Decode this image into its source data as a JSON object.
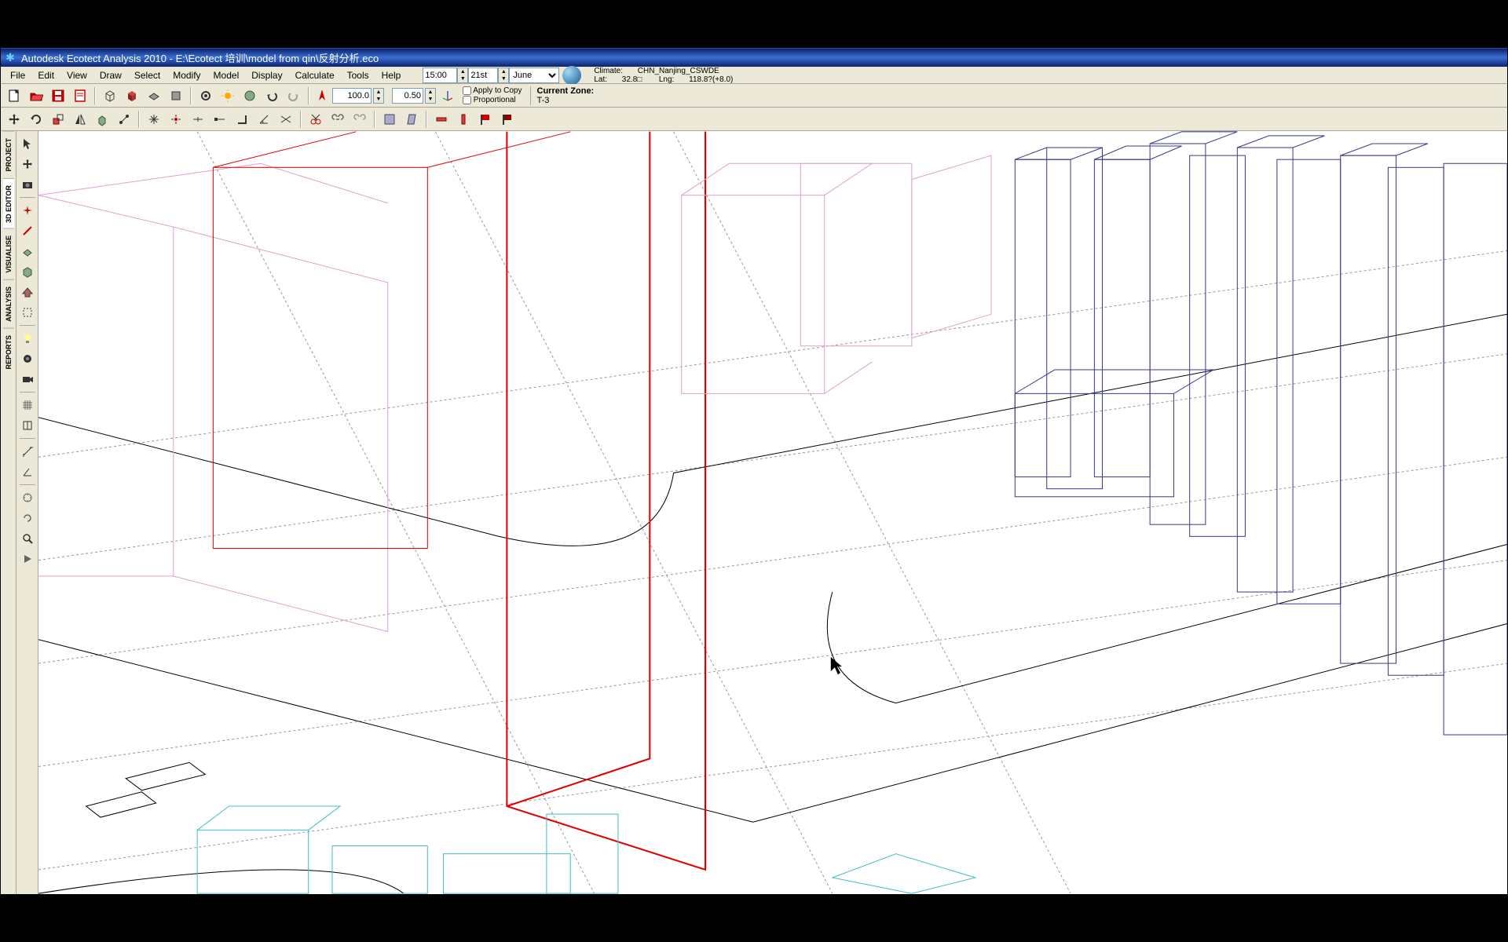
{
  "titlebar": {
    "app_name": "Autodesk Ecotect Analysis 2010",
    "file_path": "E:\\Ecotect 培训\\model from qin\\反射分析.eco"
  },
  "menu": {
    "file": "File",
    "edit": "Edit",
    "view": "View",
    "draw": "Draw",
    "select": "Select",
    "modify": "Modify",
    "model": "Model",
    "display": "Display",
    "calculate": "Calculate",
    "tools": "Tools",
    "help": "Help"
  },
  "datetime": {
    "time": "15:00",
    "day": "21st",
    "month": "June"
  },
  "climate": {
    "label": "Climate:",
    "location": "CHN_Nanjing_CSWDE",
    "lat_label": "Lat:",
    "lat_value": "32.8□",
    "lng_label": "Lng:",
    "lng_value": "118.8?(+8.0)"
  },
  "transform": {
    "north_angle": "100.0",
    "step_value": "0.50",
    "apply_label": "Apply to Copy",
    "prop_label": "Proportional"
  },
  "zone": {
    "title": "Current Zone:",
    "name": "T-3"
  },
  "left_tabs": {
    "project": "PROJECT",
    "editor": "3D EDITOR",
    "visualise": "VISUALISE",
    "analysis": "ANALYSIS",
    "reports": "REPORTS"
  },
  "icons": {
    "new": "new-file-icon",
    "open": "open-file-icon",
    "save": "save-icon",
    "page": "page-icon"
  }
}
